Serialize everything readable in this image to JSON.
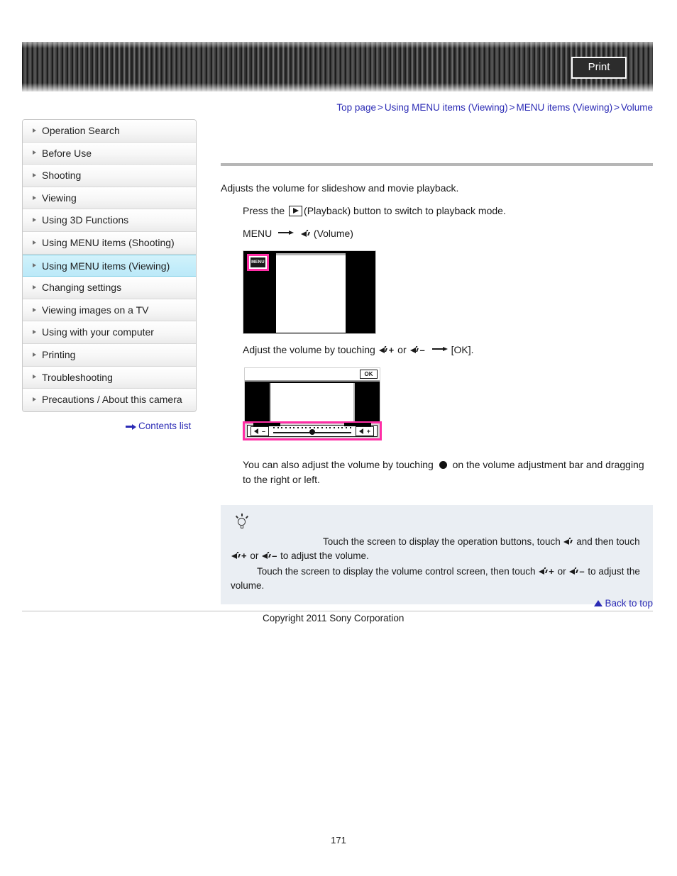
{
  "header": {
    "print_label": "Print"
  },
  "breadcrumb": {
    "separator": ">",
    "items": [
      {
        "label": "Top page"
      },
      {
        "label": "Using MENU items (Viewing)"
      },
      {
        "label": "MENU items (Viewing)"
      },
      {
        "label": "Volume"
      }
    ]
  },
  "sidebar": {
    "items": [
      {
        "label": "Operation Search",
        "active": false
      },
      {
        "label": "Before Use",
        "active": false
      },
      {
        "label": "Shooting",
        "active": false
      },
      {
        "label": "Viewing",
        "active": false
      },
      {
        "label": "Using 3D Functions",
        "active": false
      },
      {
        "label": "Using MENU items (Shooting)",
        "active": false
      },
      {
        "label": "Using MENU items (Viewing)",
        "active": true
      },
      {
        "label": "Changing settings",
        "active": false
      },
      {
        "label": "Viewing images on a TV",
        "active": false
      },
      {
        "label": "Using with your computer",
        "active": false
      },
      {
        "label": "Printing",
        "active": false
      },
      {
        "label": "Troubleshooting",
        "active": false
      },
      {
        "label": "Precautions / About this camera",
        "active": false
      }
    ],
    "contents_list_label": "Contents list"
  },
  "main": {
    "intro": "Adjusts the volume for slideshow and movie playback.",
    "step1_pre": "Press the",
    "step1_post": "(Playback) button to switch to playback mode.",
    "step2_menu": "MENU",
    "step2_volume": "(Volume)",
    "fig1": {
      "menu_button_label": "MENU"
    },
    "step3_pre": "Adjust the volume by touching",
    "step3_plus": "+",
    "step3_or": "or",
    "step3_minus": "–",
    "step3_post": "[OK].",
    "fig2": {
      "ok_label": "OK",
      "minus_sign": "–",
      "plus_sign": "+"
    },
    "drag_note_pre": "You can also adjust the volume by touching",
    "drag_note_post": "on the volume adjustment bar and dragging to the right or left."
  },
  "tip": {
    "line1_pre": "Touch the screen to display the operation buttons, touch",
    "line1_mid": "and then touch",
    "line1_plus": "+",
    "line1_or": "or",
    "line1_minus": "–",
    "line1_post": "to adjust the volume.",
    "line2_pre": "Touch the screen to display the volume control screen, then touch",
    "line2_plus": "+",
    "line2_or": "or",
    "line2_minus": "–",
    "line2_post": "to adjust the volume."
  },
  "footer": {
    "back_to_top_label": "Back to top",
    "copyright": "Copyright 2011 Sony Corporation",
    "page_number": "171"
  },
  "colors": {
    "link": "#2b2bb5",
    "highlight_magenta": "#ff2ea6",
    "sidebar_active": "#c3edfa",
    "tip_background": "#eaeef3",
    "header_dark": "#3a3a3a"
  }
}
